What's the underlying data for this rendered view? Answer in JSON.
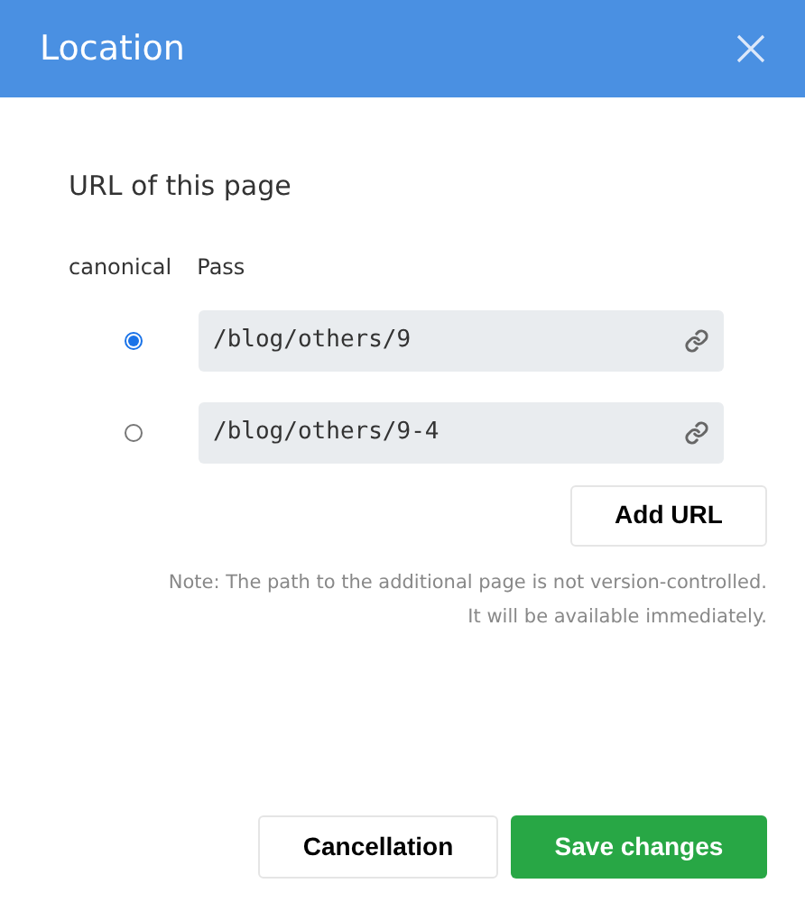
{
  "window": {
    "title": "Location"
  },
  "section_title": "URL of this page",
  "columns": [
    "canonical",
    "Pass"
  ],
  "urls": [
    {
      "value": "/blog/others/9",
      "selected": true
    },
    {
      "value": "/blog/others/9-4",
      "selected": false
    }
  ],
  "add_button": "Add URL",
  "note": [
    "Note: The path to the additional page is not version-controlled.",
    "It will be available immediately."
  ],
  "buttons": {
    "cancel": "Cancellation",
    "save": "Save changes"
  }
}
